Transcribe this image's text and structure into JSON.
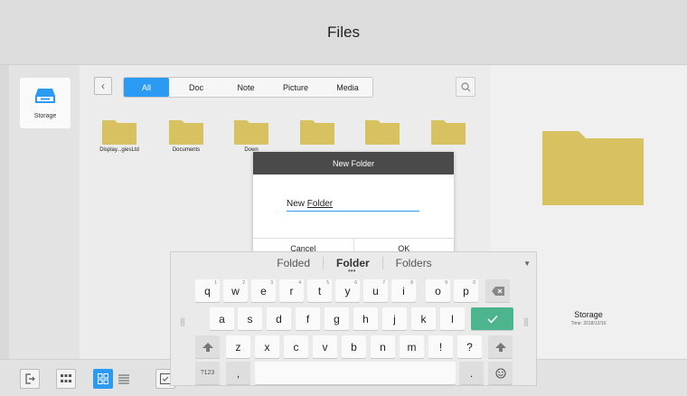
{
  "app": {
    "title": "Files"
  },
  "left_panel": {
    "storage_label": "Storage"
  },
  "tabs": [
    "All",
    "Doc",
    "Note",
    "Picture",
    "Media"
  ],
  "folders": [
    "Display...giesLtd",
    "Documents",
    "Down",
    "",
    "",
    ""
  ],
  "detail": {
    "name": "Storage",
    "time": "Time: 2018/12/10"
  },
  "dialog": {
    "title": "New Folder",
    "input_prefix": "New ",
    "input_underlined": "Folder",
    "cancel": "Cancel",
    "ok": "OK"
  },
  "keyboard": {
    "suggestions": [
      "Folded",
      "Folder",
      "Folders"
    ],
    "row1": [
      "q",
      "w",
      "e",
      "r",
      "t",
      "y",
      "u",
      "i",
      "o",
      "p"
    ],
    "row1_sup": [
      "1",
      "2",
      "3",
      "4",
      "5",
      "6",
      "7",
      "8",
      "9",
      "0"
    ],
    "row2": [
      "a",
      "s",
      "d",
      "f",
      "g",
      "h",
      "j",
      "k",
      "l"
    ],
    "row3": [
      "z",
      "x",
      "c",
      "v",
      "b",
      "n",
      "m",
      "!",
      "?"
    ],
    "symbols_label": "?123",
    "comma": ",",
    "period": "."
  },
  "colors": {
    "accent": "#2b9af3",
    "folder": "#d7c161",
    "enter": "#4cb58e",
    "dialog_header": "#4a4a4a"
  }
}
